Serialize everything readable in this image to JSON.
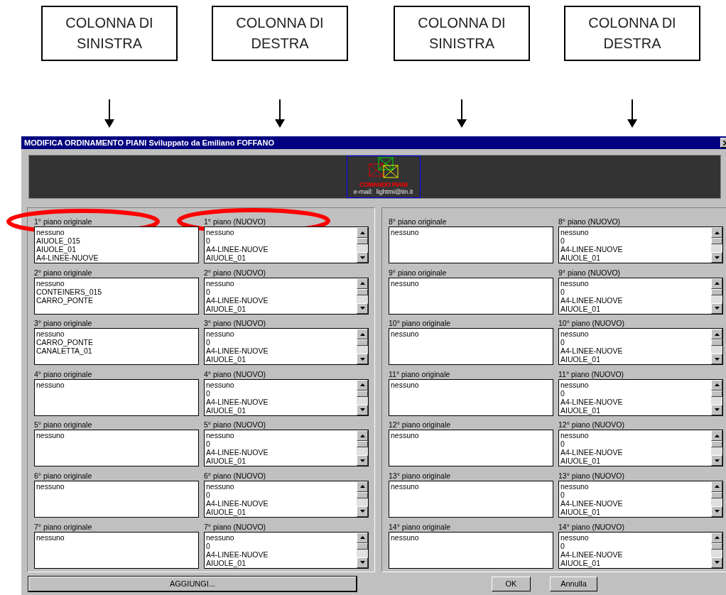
{
  "annotations": {
    "labels": [
      {
        "text": "COLONNA DI SINISTRA"
      },
      {
        "text": "COLONNA DI DESTRA"
      },
      {
        "text": "COLONNA DI SINISTRA"
      },
      {
        "text": "COLONNA DI DESTRA"
      }
    ],
    "highlights": [
      {
        "kind": "ellipse"
      },
      {
        "kind": "ellipse"
      }
    ]
  },
  "dialog": {
    "title": "MODIFICA ORDINAMENTO PIANI Sviluppato da Emiliano FOFFANO",
    "logo": {
      "name": "COMANDO PIANI",
      "email": "e-mail:  lightmi@tin.it"
    },
    "panels": [
      {
        "rows": [
          {
            "original": {
              "label": "1° piano originale",
              "items": [
                "nessuno",
                "AIUOLE_015",
                "AIUOLE_01",
                "A4-LINEE-NUOVE"
              ]
            },
            "nuovo": {
              "label": "1° piano (NUOVO)",
              "items": [
                "nessuno",
                "0",
                "A4-LINEE-NUOVE",
                "AIUOLE_01"
              ]
            }
          },
          {
            "original": {
              "label": "2° piano originale",
              "items": [
                "nessuno",
                "CONTEINERS_015",
                "CARRO_PONTE"
              ]
            },
            "nuovo": {
              "label": "2° piano (NUOVO)",
              "items": [
                "nessuno",
                "0",
                "A4-LINEE-NUOVE",
                "AIUOLE_01"
              ]
            }
          },
          {
            "original": {
              "label": "3° piano originale",
              "items": [
                "nessuno",
                "CARRO_PONTE",
                "CANALETTA_01"
              ]
            },
            "nuovo": {
              "label": "3° piano (NUOVO)",
              "items": [
                "nessuno",
                "0",
                "A4-LINEE-NUOVE",
                "AIUOLE_01"
              ]
            }
          },
          {
            "original": {
              "label": "4° piano originale",
              "items": [
                "nessuno"
              ]
            },
            "nuovo": {
              "label": "4° piano (NUOVO)",
              "items": [
                "nessuno",
                "0",
                "A4-LINEE-NUOVE",
                "AIUOLE_01"
              ]
            }
          },
          {
            "original": {
              "label": "5° piano originale",
              "items": [
                "nessuno"
              ]
            },
            "nuovo": {
              "label": "5° piano (NUOVO)",
              "items": [
                "nessuno",
                "0",
                "A4-LINEE-NUOVE",
                "AIUOLE_01"
              ]
            }
          },
          {
            "original": {
              "label": "6° piano originale",
              "items": [
                "nessuno"
              ]
            },
            "nuovo": {
              "label": "6° piano (NUOVO)",
              "items": [
                "nessuno",
                "0",
                "A4-LINEE-NUOVE",
                "AIUOLE_01"
              ]
            }
          },
          {
            "original": {
              "label": "7° piano originale",
              "items": [
                "nessuno"
              ]
            },
            "nuovo": {
              "label": "7° piano (NUOVO)",
              "items": [
                "nessuno",
                "0",
                "A4-LINEE-NUOVE",
                "AIUOLE_01"
              ]
            }
          }
        ]
      },
      {
        "rows": [
          {
            "original": {
              "label": "8° piano originale",
              "items": [
                "nessuno"
              ]
            },
            "nuovo": {
              "label": "8° piano (NUOVO)",
              "items": [
                "nessuno",
                "0",
                "A4-LINEE-NUOVE",
                "AIUOLE_01"
              ]
            }
          },
          {
            "original": {
              "label": "9° piano originale",
              "items": [
                "nessuno"
              ]
            },
            "nuovo": {
              "label": "9° piano (NUOVO)",
              "items": [
                "nessuno",
                "0",
                "A4-LINEE-NUOVE",
                "AIUOLE_01"
              ]
            }
          },
          {
            "original": {
              "label": "10° piano originale",
              "items": [
                "nessuno"
              ]
            },
            "nuovo": {
              "label": "10° piano (NUOVO)",
              "items": [
                "nessuno",
                "0",
                "A4-LINEE-NUOVE",
                "AIUOLE_01"
              ]
            }
          },
          {
            "original": {
              "label": "11° piano originale",
              "items": [
                "nessuno"
              ]
            },
            "nuovo": {
              "label": "11° piano (NUOVO)",
              "items": [
                "nessuno",
                "0",
                "A4-LINEE-NUOVE",
                "AIUOLE_01"
              ]
            }
          },
          {
            "original": {
              "label": "12° piano originale",
              "items": [
                "nessuno"
              ]
            },
            "nuovo": {
              "label": "12° piano (NUOVO)",
              "items": [
                "nessuno",
                "0",
                "A4-LINEE-NUOVE",
                "AIUOLE_01"
              ]
            }
          },
          {
            "original": {
              "label": "13° piano originale",
              "items": [
                "nessuno"
              ]
            },
            "nuovo": {
              "label": "13° piano (NUOVO)",
              "items": [
                "nessuno",
                "0",
                "A4-LINEE-NUOVE",
                "AIUOLE_01"
              ]
            }
          },
          {
            "original": {
              "label": "14° piano originale",
              "items": [
                "nessuno"
              ]
            },
            "nuovo": {
              "label": "14° piano (NUOVO)",
              "items": [
                "nessuno",
                "0",
                "A4-LINEE-NUOVE",
                "AIUOLE_01"
              ]
            }
          }
        ]
      }
    ],
    "add_button": "AGGIUNGI...",
    "ok_button": "OK",
    "cancel_button": "Annulla"
  }
}
